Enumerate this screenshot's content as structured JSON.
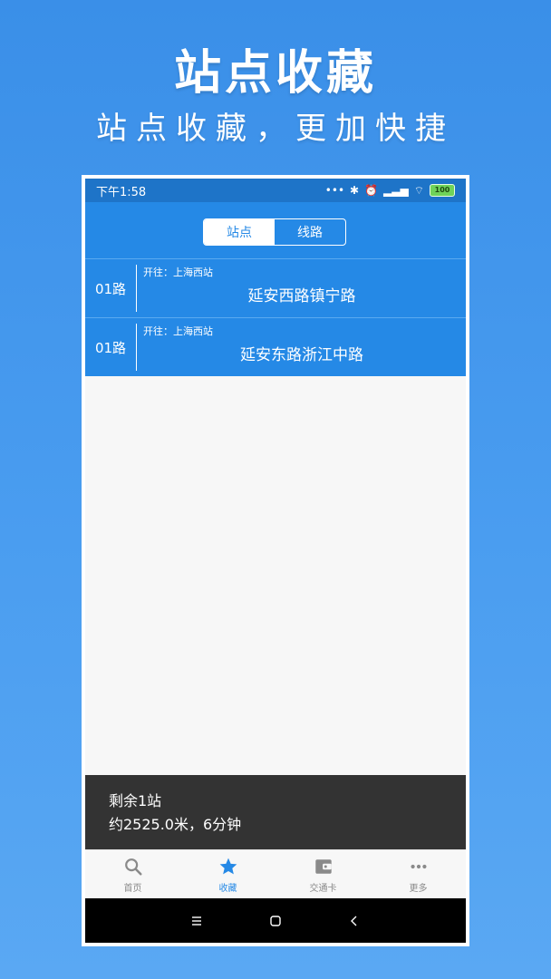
{
  "promo": {
    "title": "站点收藏",
    "subtitle": "站点收藏，更加快捷"
  },
  "status_bar": {
    "time": "下午1:58",
    "battery": "100"
  },
  "segmented": {
    "tabs": [
      {
        "label": "站点",
        "active": true
      },
      {
        "label": "线路",
        "active": false
      }
    ]
  },
  "favorites": [
    {
      "route": "01路",
      "toward": "开往：上海西站",
      "station": "延安西路镇宁路"
    },
    {
      "route": "01路",
      "toward": "开往：上海西站",
      "station": "延安东路浙江中路"
    }
  ],
  "toast": {
    "line1": "剩余1站",
    "line2": "约2525.0米，6分钟"
  },
  "tabbar": {
    "items": [
      {
        "label": "首页",
        "icon": "search-icon",
        "active": false
      },
      {
        "label": "收藏",
        "icon": "star-icon",
        "active": true
      },
      {
        "label": "交通卡",
        "icon": "wallet-icon",
        "active": false
      },
      {
        "label": "更多",
        "icon": "more-icon",
        "active": false
      }
    ]
  },
  "colors": {
    "primary": "#2589e6",
    "statusbar": "#1e74c8",
    "toast": "#333333"
  }
}
